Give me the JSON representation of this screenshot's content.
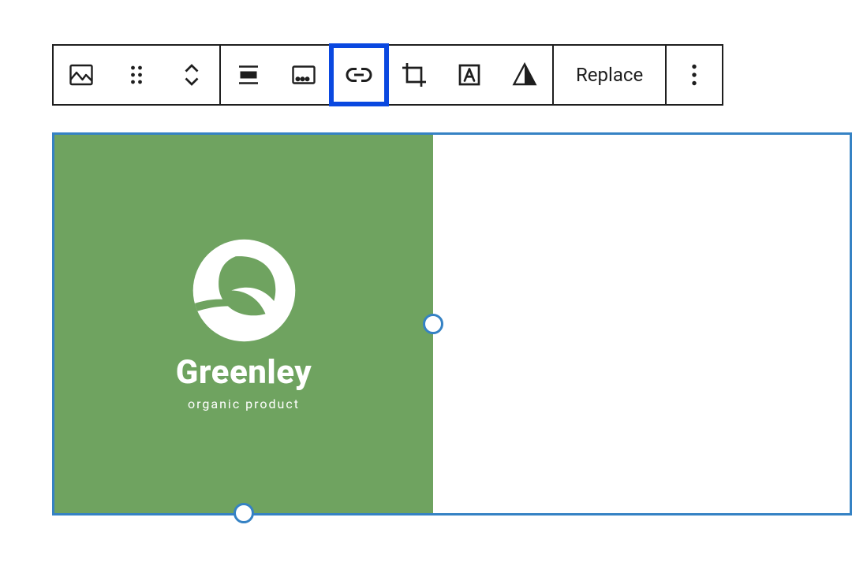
{
  "toolbar": {
    "replace_label": "Replace"
  },
  "image": {
    "brand": "Greenley",
    "tagline": "organic product",
    "bg_color": "#6fa360"
  },
  "colors": {
    "selection_blue": "#0a48e0",
    "canvas_border": "#3582c4"
  }
}
